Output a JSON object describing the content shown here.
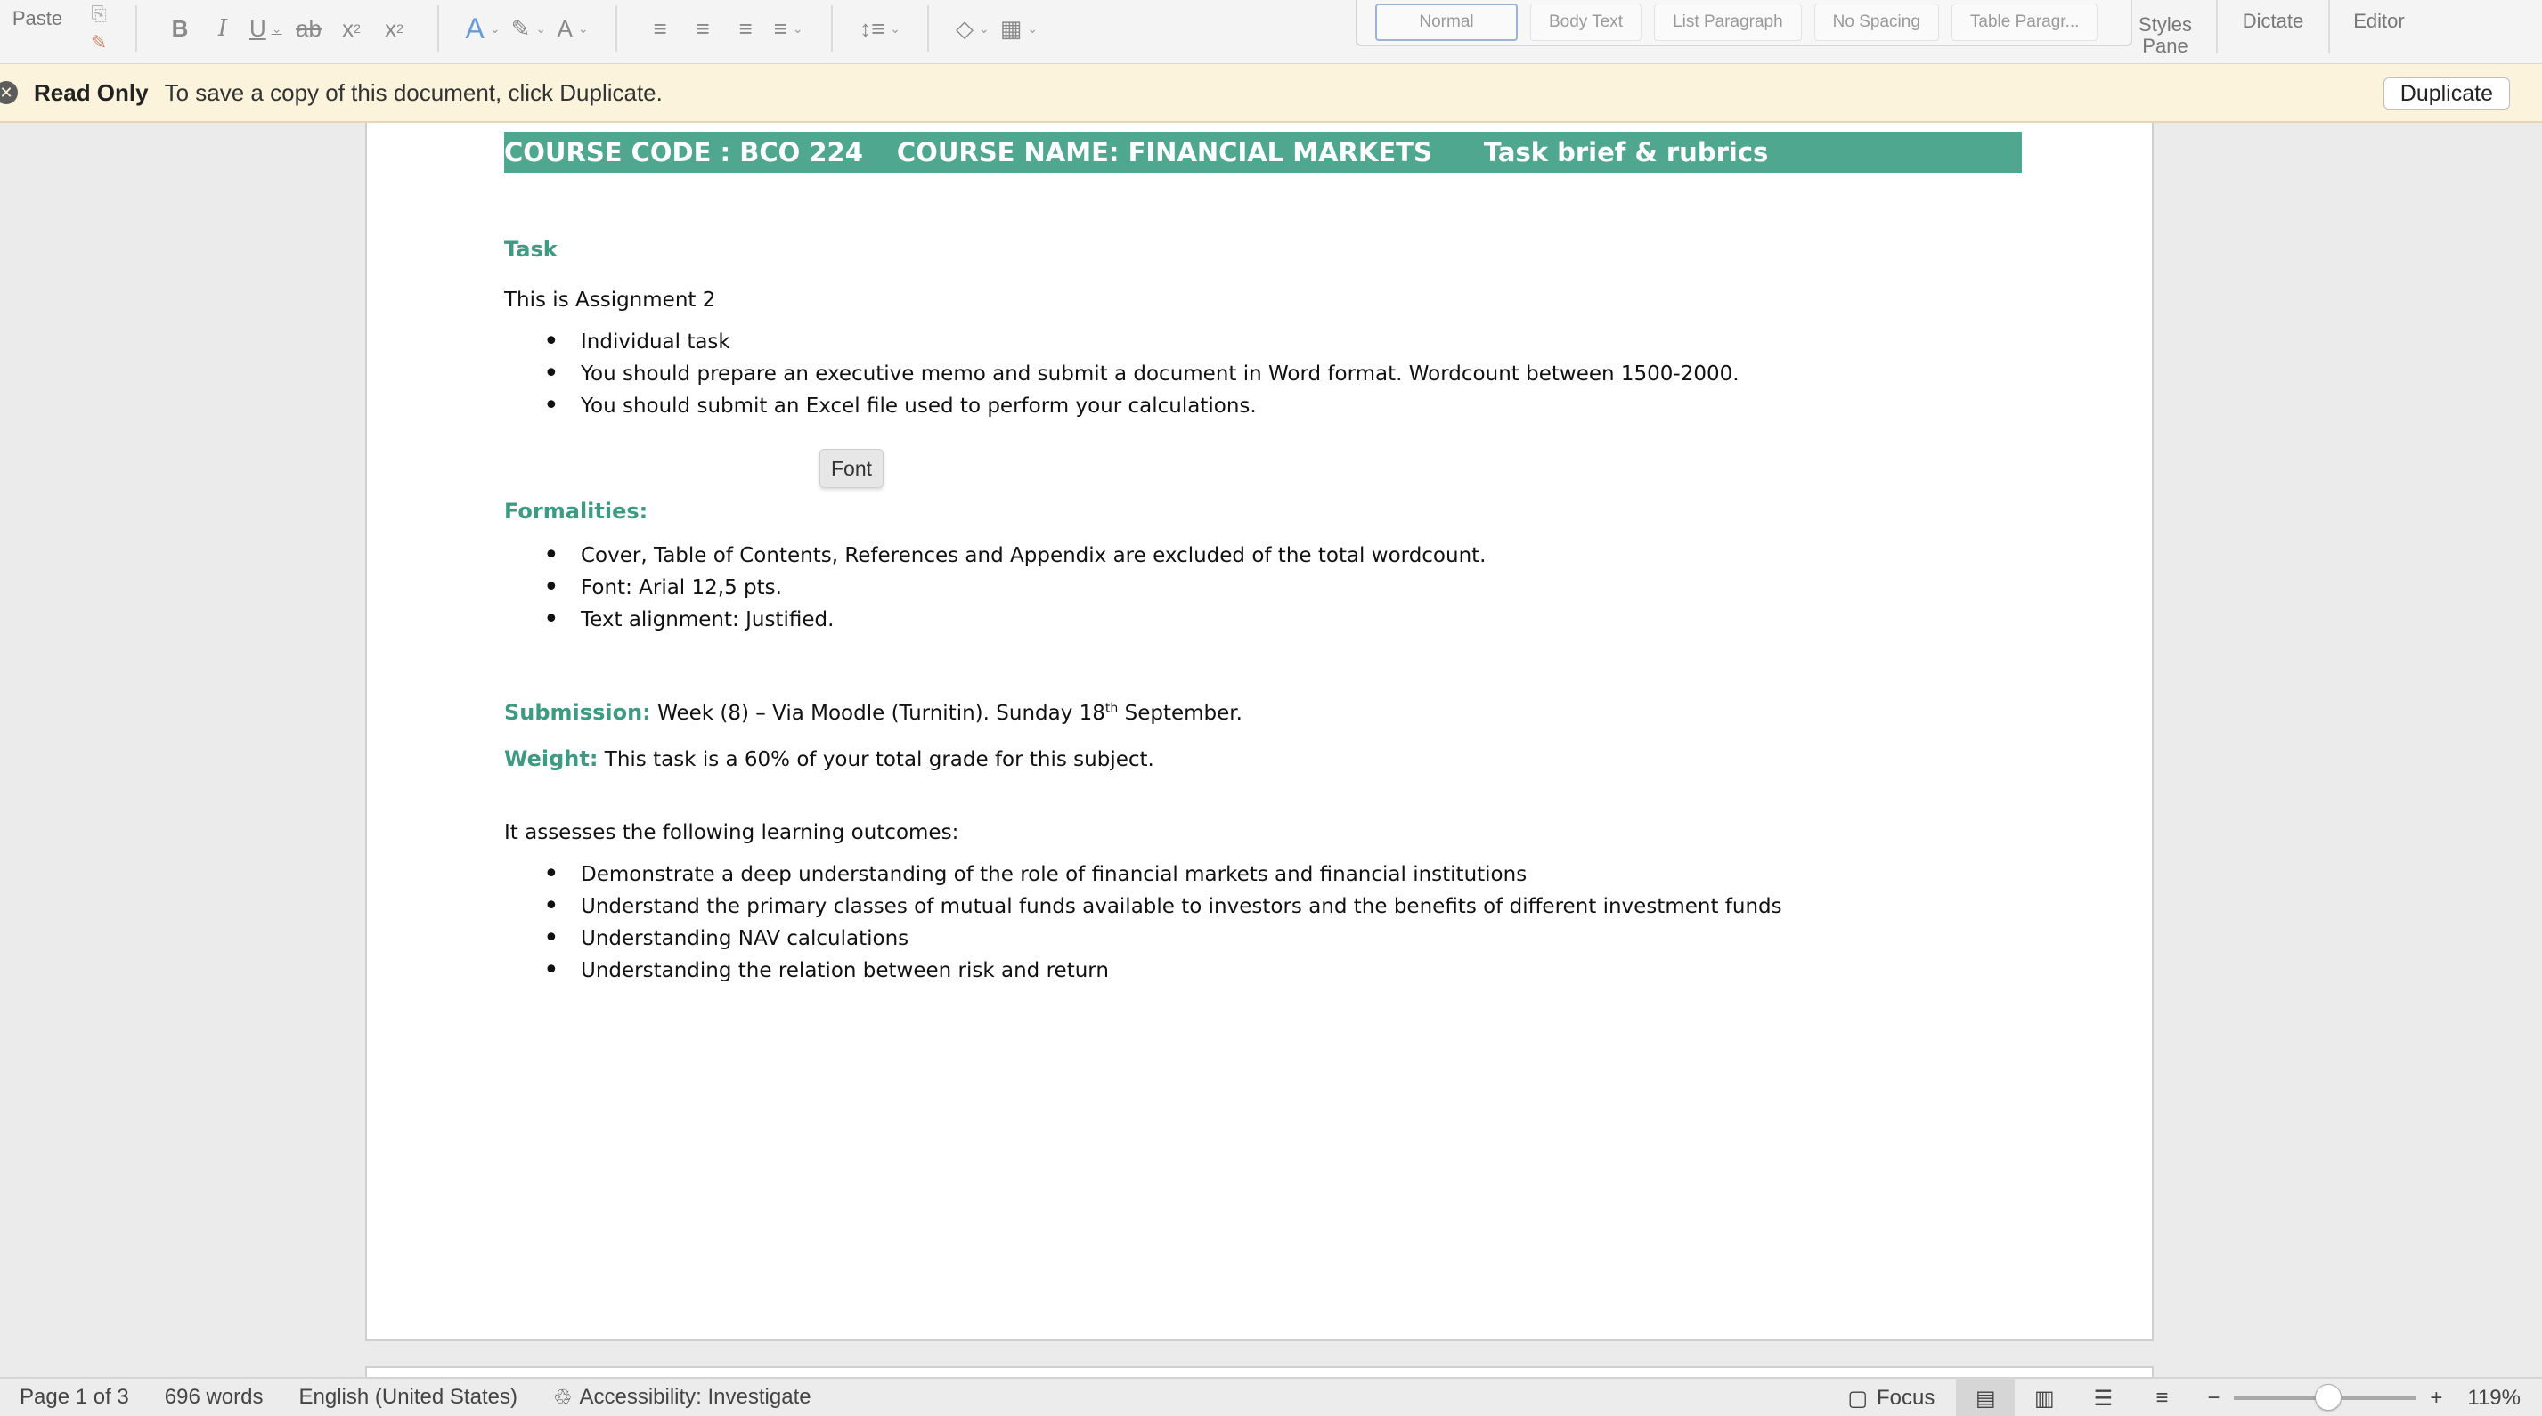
{
  "ribbon": {
    "paste_label": "Paste",
    "styles": [
      "Normal",
      "Body Text",
      "List Paragraph",
      "No Spacing",
      "Table Paragr..."
    ],
    "styles_pane_label": "Styles\nPane",
    "dictate_label": "Dictate",
    "editor_label": "Editor"
  },
  "readonly": {
    "title": "Read Only",
    "message": "To save a copy of this document, click Duplicate.",
    "duplicate_label": "Duplicate"
  },
  "doc": {
    "heading": {
      "code": "COURSE CODE : BCO 224",
      "name": "COURSE NAME: FINANCIAL MARKETS",
      "brief": "Task brief & rubrics"
    },
    "task_heading": "Task",
    "intro": "This is Assignment 2",
    "task_bullets": [
      "Individual task",
      "You should prepare an executive memo and submit a document in Word format. Wordcount between 1500-2000.",
      "You should submit an Excel file used to perform your calculations."
    ],
    "tooltip": "Font",
    "formalities_heading": "Formalities:",
    "formalities_bullets": [
      "Cover, Table of Contents, References and Appendix are excluded of the total wordcount.",
      "Font: Arial 12,5 pts.",
      "Text alignment: Justified."
    ],
    "submission_label": "Submission:",
    "submission_text_pre": "Week (8) – Via Moodle (Turnitin). Sunday 18",
    "submission_sup": "th",
    "submission_text_post": " September.",
    "weight_label": "Weight:",
    "weight_text": "This task is a 60% of your total grade for this subject.",
    "outcomes_intro": "It assesses the following learning outcomes:",
    "outcomes_bullets": [
      "Demonstrate a deep understanding of the role of financial markets and financial institutions",
      "Understand the primary classes of mutual funds available to investors and the benefits of different investment funds",
      "Understanding NAV calculations",
      "Understanding the relation between risk and return"
    ]
  },
  "status": {
    "page": "Page 1 of 3",
    "words": "696 words",
    "language": "English (United States)",
    "accessibility": "Accessibility: Investigate",
    "focus": "Focus",
    "zoom": "119%",
    "zoom_level": 0.52
  },
  "colors": {
    "accent": "#4fa78f",
    "heading_text": "#3e9a83",
    "readonly_bg": "#fbf3dc"
  }
}
